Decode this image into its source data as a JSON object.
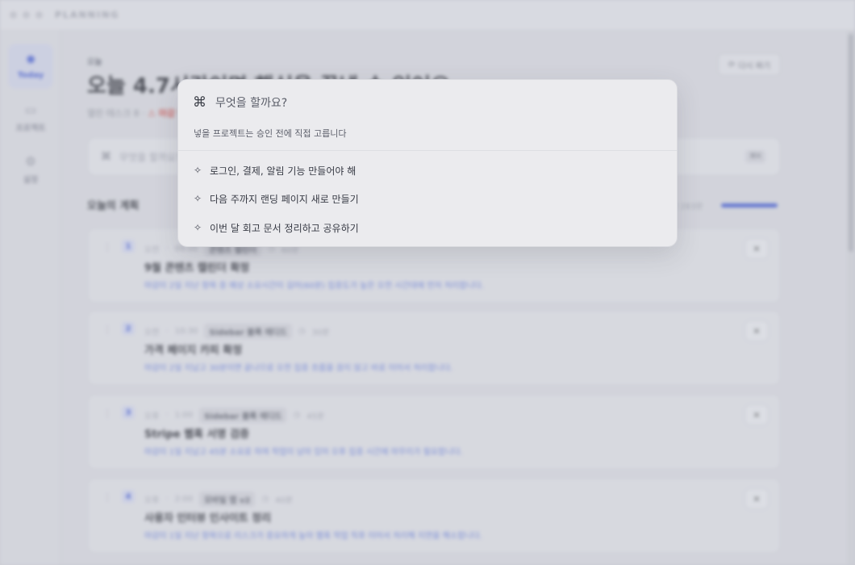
{
  "app": {
    "name": "PLANNING"
  },
  "sidebar": {
    "items": [
      {
        "label": "Today",
        "icon": "sun-icon",
        "active": true
      },
      {
        "label": "프로젝트",
        "icon": "folder-icon",
        "active": false
      },
      {
        "label": "설정",
        "icon": "gear-icon",
        "active": false
      }
    ]
  },
  "header": {
    "eyebrow": "오늘",
    "headline": "오늘 4.7시간이면 핵심을 끝낼 수 있어요.",
    "subline": "열린 태스크 8 ·",
    "warning": "⚠ 마감 임박 3",
    "retry_label": "다시 짜기"
  },
  "command_bar": {
    "placeholder": "무엇을 할까요? 자연어로 입력하세요",
    "shortcut": "⌘K"
  },
  "plan": {
    "title": "오늘의 계획",
    "progress_label": "0분 / 283분",
    "progress": 1.0
  },
  "tasks": [
    {
      "num": "1",
      "meta_time": "오전",
      "meta_slot": "09:00",
      "tag": "콘텐츠 캘린더",
      "duration": "60분",
      "title": "9월 콘텐츠 캘린더 확정",
      "desc": "마감이 2일 지난 항목 중 예상 소요시간이 길어(60분) 집중도가 높은 오전 시간대에 먼저 처리합니다."
    },
    {
      "num": "2",
      "meta_time": "오전",
      "meta_slot": "10:30",
      "tag": "Sidebar 블록 에디드",
      "duration": "30분",
      "title": "가격 페이지 카피 확정",
      "desc": "마감이 2일 지났고 30분이면 끝나므로 오전 집중 흐름을 끊지 않고 바로 이어서 처리합니다."
    },
    {
      "num": "3",
      "meta_time": "오후",
      "meta_slot": "1:00",
      "tag": "Sidebar 블록 에디드",
      "duration": "45분",
      "title": "Stripe 웹훅 서명 검증",
      "desc": "마감이 1일 지났고 45분 소요로 하여 작업이 남아 있어 오후 집중 시간에 마무리가 필요합니다."
    },
    {
      "num": "4",
      "meta_time": "오후",
      "meta_slot": "2:00",
      "tag": "모바일 앱 v2",
      "duration": "40분",
      "title": "사용자 인터뷰 인사이트 정리",
      "desc": "마감이 1일 지난 항목으로 리스크가 중요하게 높아 웹훅 작업 직후 이어서 처리해 지연을 해소합니다."
    }
  ],
  "palette": {
    "placeholder": "무엇을 할까요?",
    "hint": "넣을 프로젝트는 승인 전에 직접 고릅니다",
    "suggestions": [
      "로그인, 결제, 알림 기능 만들어야 해",
      "다음 주까지 랜딩 페이지 새로 만들기",
      "이번 달 회고 문서 정리하고 공유하기"
    ]
  }
}
